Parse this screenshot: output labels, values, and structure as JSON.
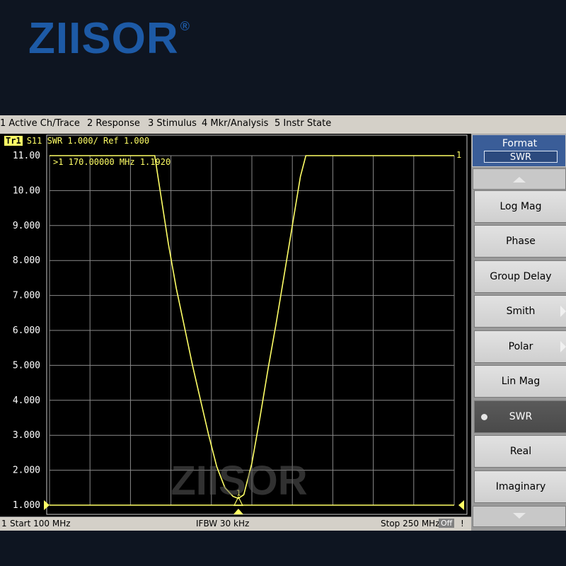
{
  "brand": {
    "logo_text": "ZIISOR",
    "registered_mark": "®",
    "watermark_text": "ZIISOR"
  },
  "menu": {
    "items": [
      {
        "label": "1 Active Ch/Trace"
      },
      {
        "label": "2 Response"
      },
      {
        "label": "3 Stimulus"
      },
      {
        "label": "4 Mkr/Analysis"
      },
      {
        "label": "5 Instr State"
      }
    ]
  },
  "trace": {
    "badge": "Tr1",
    "header": "S11  SWR 1.000/ Ref 1.000",
    "marker_readout": ">1  170.00000 MHz  1.1920",
    "right_channel_label": "1",
    "marker_label": "1"
  },
  "status": {
    "channel": "1",
    "start": "Start 100 MHz",
    "ifbw": "IFBW 30 kHz",
    "stop": "Stop 250 MHz",
    "off_badge": "Off",
    "excl": "!"
  },
  "softkeys": {
    "format_title": "Format",
    "format_value": "SWR",
    "items": [
      {
        "label": "Log Mag",
        "active": false,
        "submenu": false
      },
      {
        "label": "Phase",
        "active": false,
        "submenu": false
      },
      {
        "label": "Group Delay",
        "active": false,
        "submenu": false
      },
      {
        "label": "Smith",
        "active": false,
        "submenu": true
      },
      {
        "label": "Polar",
        "active": false,
        "submenu": true
      },
      {
        "label": "Lin Mag",
        "active": false,
        "submenu": false
      },
      {
        "label": "SWR",
        "active": true,
        "submenu": false
      },
      {
        "label": "Real",
        "active": false,
        "submenu": false
      },
      {
        "label": "Imaginary",
        "active": false,
        "submenu": false
      }
    ]
  },
  "colors": {
    "trace": "#ffff66",
    "grid": "#8a8a8a",
    "background": "#000000"
  },
  "chart_data": {
    "type": "line",
    "title": "",
    "xlabel": "",
    "ylabel": "",
    "xlim": [
      100,
      250
    ],
    "ylim": [
      1.0,
      11.0
    ],
    "y_tick_labels": [
      "11.00",
      "10.00",
      "9.000",
      "8.000",
      "7.000",
      "6.000",
      "5.000",
      "4.000",
      "3.000",
      "2.000",
      "1.000"
    ],
    "grid": true,
    "series": [
      {
        "name": "",
        "x": [
          100,
          139,
          141,
          144,
          147,
          150,
          153,
          156,
          159,
          162,
          165,
          168,
          170,
          172,
          175,
          178,
          181,
          184,
          187,
          190,
          193,
          195,
          250
        ],
        "y": [
          11,
          11,
          10.0,
          8.5,
          7.2,
          6.1,
          5.0,
          4.0,
          3.0,
          2.1,
          1.5,
          1.25,
          1.192,
          1.3,
          2.2,
          3.5,
          4.9,
          6.2,
          7.6,
          9.0,
          10.4,
          11,
          11
        ]
      }
    ],
    "marker": {
      "x": 170.0,
      "y": 1.192,
      "label": "1"
    }
  }
}
